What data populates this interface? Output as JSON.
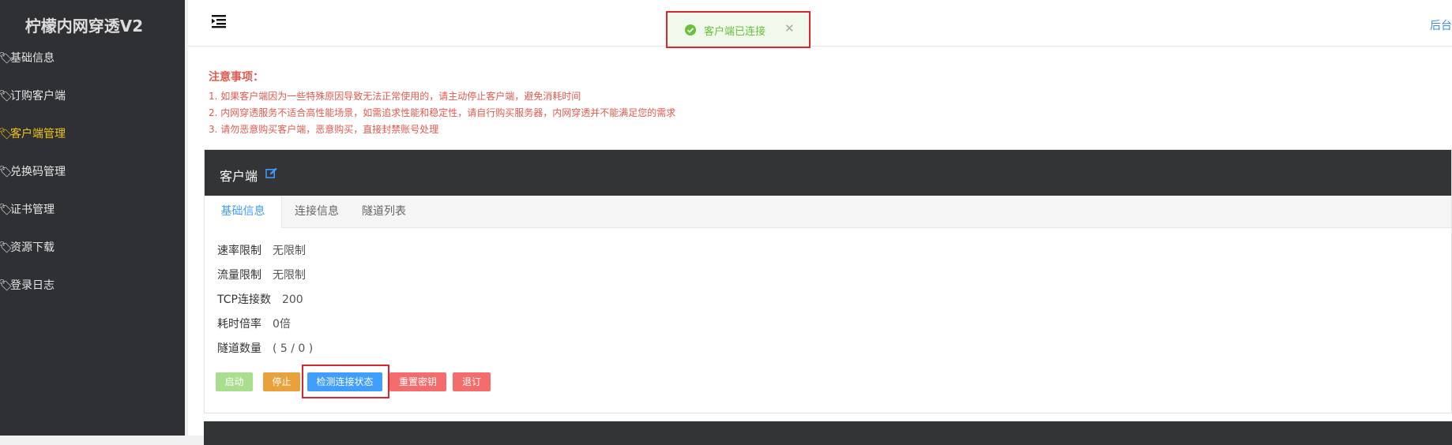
{
  "sidebar": {
    "brand": "柠檬内网穿透V2",
    "items": [
      {
        "label": "基础信息",
        "icon": "tag-icon"
      },
      {
        "label": "订购客户端",
        "icon": "tag-icon"
      },
      {
        "label": "客户端管理",
        "icon": "tag-icon",
        "active": true
      },
      {
        "label": "兑换码管理",
        "icon": "tag-icon"
      },
      {
        "label": "证书管理",
        "icon": "tag-icon"
      },
      {
        "label": "资源下载",
        "icon": "tag-icon"
      },
      {
        "label": "登录日志",
        "icon": "tag-icon"
      }
    ]
  },
  "topbar": {
    "menu_icon": "menu-fold-icon",
    "right_link": "后台"
  },
  "toast": {
    "icon": "check-circle-icon",
    "message": "客户端已连接",
    "close": "✕"
  },
  "notice": {
    "title": "注意事项：",
    "lines": [
      "1. 如果客户端因为一些特殊原因导致无法正常使用的，请主动停止客户端，避免消耗时间",
      "2. 内网穿透服务不适合高性能场景，如需追求性能和稳定性，请自行购买服务器，内网穿透并不能满足您的需求",
      "3. 请勿恶意购买客户端，恶意购买，直接封禁账号处理"
    ]
  },
  "card": {
    "title": "客户端",
    "edit_icon": "edit-icon",
    "tabs": [
      {
        "label": "基础信息",
        "active": true
      },
      {
        "label": "连接信息"
      },
      {
        "label": "隧道列表"
      }
    ],
    "rows": [
      {
        "label": "速率限制",
        "value": "无限制"
      },
      {
        "label": "流量限制",
        "value": "无限制"
      },
      {
        "label": "TCP连接数",
        "value": "200"
      },
      {
        "label": "耗时倍率",
        "value": "0倍"
      },
      {
        "label": "隧道数量",
        "value": "( 5 / 0 )"
      }
    ],
    "buttons": {
      "start": "启动",
      "stop": "停止",
      "check": "检测连接状态",
      "reset": "重置密钥",
      "unsubscribe": "退订"
    }
  },
  "colors": {
    "sidebar_bg": "#2f3033",
    "active_nav": "#f0c419",
    "notice_red": "#e05a4f",
    "primary_blue": "#409eff",
    "success_green": "#67c23a",
    "danger_red": "#f56c6c",
    "warning_orange": "#e9a23b"
  }
}
